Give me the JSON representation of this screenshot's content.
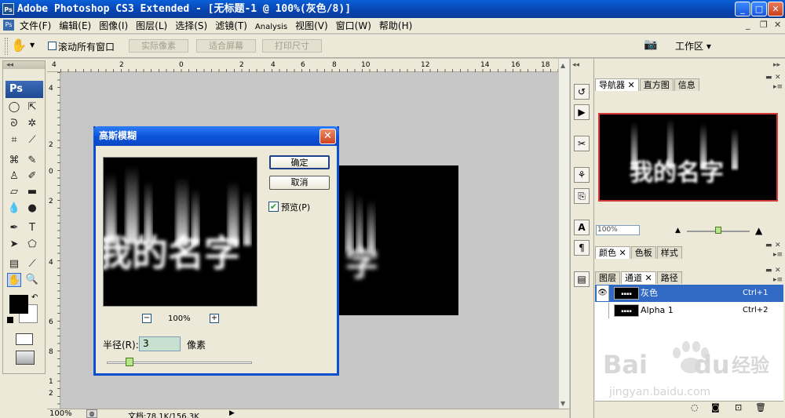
{
  "app": {
    "logo": "Ps",
    "title": "Adobe Photoshop CS3 Extended - [无标题-1 @ 100%(灰色/8)]"
  },
  "window_buttons": {
    "minimize": "_",
    "maximize": "□",
    "close": "✕"
  },
  "menu": {
    "icon": "Ps",
    "items": [
      "文件(F)",
      "编辑(E)",
      "图像(I)",
      "图层(L)",
      "选择(S)",
      "滤镜(T)",
      "Analysis",
      "视图(V)",
      "窗口(W)",
      "帮助(H)"
    ],
    "mdi_buttons": [
      "_",
      "❐",
      "✕"
    ]
  },
  "options_bar": {
    "tool_icon": "hand-tool-icon",
    "scroll_all_label": "滚动所有窗口",
    "actual_pixels": "实际像素",
    "fit_screen": "适合屏幕",
    "print_size": "打印尺寸",
    "workspace_label": "工作区 ▾"
  },
  "toolbox": {
    "logo": "Ps"
  },
  "rulers": {
    "top_ticks": [
      "4",
      "2",
      "0",
      "2",
      "4",
      "6",
      "8",
      "10",
      "12",
      "14",
      "16",
      "18"
    ],
    "left_ticks": [
      "4",
      "2",
      "0",
      "2",
      "4",
      "6",
      "8",
      "1",
      "2"
    ]
  },
  "document": {
    "image_text": "我的名字",
    "visible_text": "字"
  },
  "status_bar": {
    "zoom": "100%",
    "doc_info": "文档:78.1K/156.3K"
  },
  "dialog": {
    "title": "高斯模糊",
    "ok": "确定",
    "cancel": "取消",
    "preview_label": "预览(P)",
    "preview_checked": true,
    "preview_text": "我的名字",
    "zoom_minus": "−",
    "zoom_plus": "+",
    "zoom_level": "100%",
    "radius_label": "半径(R):",
    "radius_value": "3",
    "radius_unit": "像素",
    "radius_slider_fraction": 0.1
  },
  "panels": {
    "navigator": {
      "tabs": [
        "导航器",
        "直方图",
        "信息"
      ],
      "preview_text": "我的名字",
      "zoom": "100%"
    },
    "color": {
      "tabs": [
        "颜色",
        "色板",
        "样式"
      ]
    },
    "layers": {
      "tabs": [
        "图层",
        "通道",
        "路径"
      ],
      "channels": [
        {
          "name": "灰色",
          "shortcut": "Ctrl+1",
          "selected": true,
          "visible": true
        },
        {
          "name": "Alpha 1",
          "shortcut": "Ctrl+2",
          "selected": false,
          "visible": false
        }
      ]
    }
  },
  "watermark": {
    "brand": "Bai",
    "brand2": "du",
    "cn": "经验",
    "url": "jingyan.baidu.com"
  },
  "colors": {
    "title_blue": "#0844b0",
    "accent": "#316ac5",
    "nav_frame": "#d53a3a"
  }
}
